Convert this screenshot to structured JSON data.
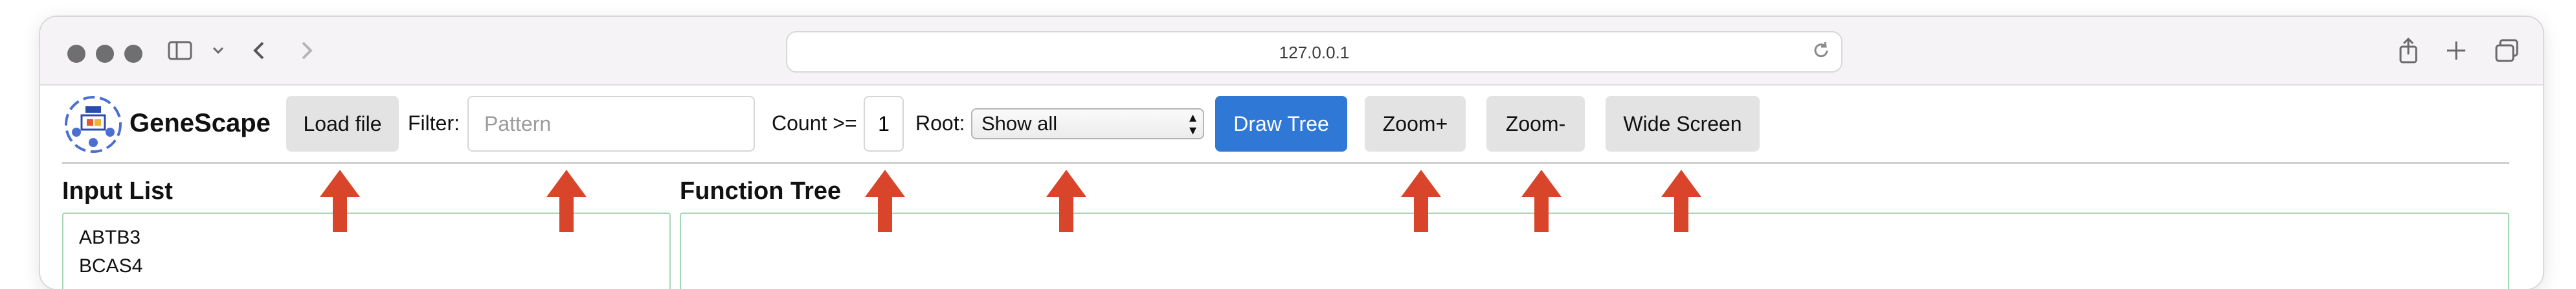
{
  "browser": {
    "address": "127.0.0.1",
    "icons": {
      "sidebar": "sidebar-icon",
      "chevron": "chevron-down-icon",
      "back": "back-icon",
      "forward": "forward-icon",
      "reload": "reload-icon",
      "share": "share-icon",
      "new_tab": "plus-icon",
      "tabs": "tabs-icon"
    }
  },
  "app": {
    "name": "GeneScape",
    "load_file": "Load file",
    "filter_label": "Filter:",
    "filter_placeholder": "Pattern",
    "count_label": "Count >=",
    "count_value": "1",
    "root_label": "Root:",
    "root_selected": "Show all",
    "draw_tree": "Draw Tree",
    "zoom_in": "Zoom+",
    "zoom_out": "Zoom-",
    "wide_screen": "Wide Screen"
  },
  "input_list": {
    "title": "Input List",
    "items": [
      "ABTB3",
      "BCAS4"
    ]
  },
  "function_tree": {
    "title": "Function Tree"
  },
  "colors": {
    "primary_button": "#2f78d6",
    "annotation_arrow": "#d9452b",
    "panel_border": "#a8d8b8"
  }
}
